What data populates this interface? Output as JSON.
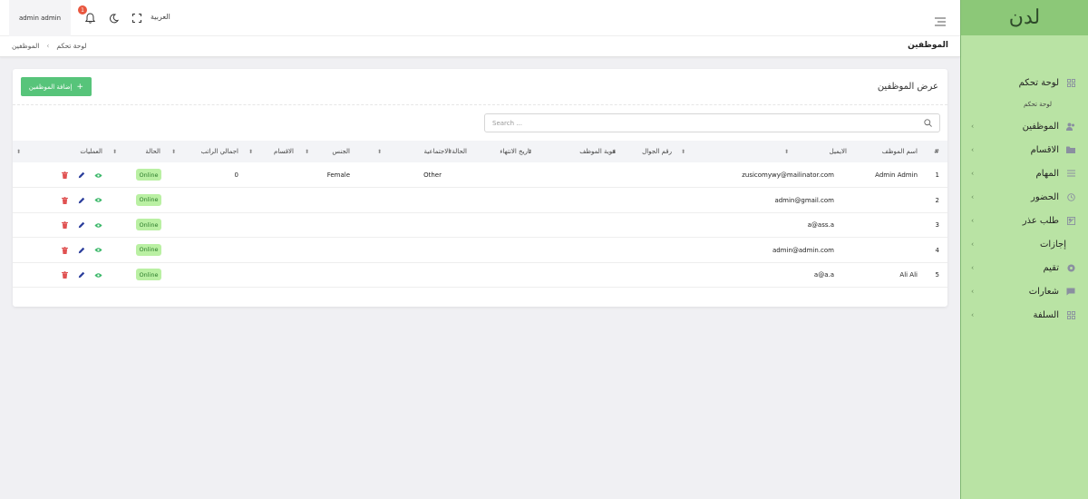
{
  "app": {
    "logo": "لدن"
  },
  "header": {
    "user": "admin admin",
    "notification_count": "1",
    "language": "العربية"
  },
  "breadcrumb": {
    "home": "لوحة تحكم",
    "current": "الموظفين"
  },
  "page": {
    "title": "الموظفين"
  },
  "card": {
    "title": "عرض الموظفين",
    "add_button": "إضافة الموظفين",
    "search_placeholder": "Search ..."
  },
  "sidebar": {
    "items": [
      {
        "label": "لوحة تحكم",
        "icon": "dashboard-icon"
      },
      {
        "label": "الموظفين",
        "icon": "users-icon"
      },
      {
        "label": "الاقسام",
        "icon": "folder-icon"
      },
      {
        "label": "المهام",
        "icon": "list-icon"
      },
      {
        "label": "الحضور",
        "icon": "clock-icon"
      },
      {
        "label": "طلب عذر",
        "icon": "excuse-icon"
      },
      {
        "label": "إجازات",
        "icon": ""
      },
      {
        "label": "تقيم",
        "icon": "rating-icon"
      },
      {
        "label": "شعارات",
        "icon": "chat-icon"
      },
      {
        "label": "السلفة",
        "icon": "grid-icon"
      }
    ],
    "sub_label": "لوحة تحكم"
  },
  "table": {
    "columns": [
      "#",
      "اسم الموظف",
      "الايميل",
      "رقم الجوال",
      "هوية الموظف",
      "تاريخ الانتهاء",
      "الحالة الاجتماعية",
      "الجنس",
      "الاقسام",
      "اجمالي الراتب",
      "الحالة",
      "العمليات"
    ],
    "rows": [
      {
        "num": "1",
        "name": "Admin Admin",
        "email": "zusicomywy@mailinator.com",
        "social": "Other",
        "gender": "Female",
        "salary": "0",
        "status": "Online"
      },
      {
        "num": "2",
        "name": "",
        "email": "admin@gmail.com",
        "social": "",
        "gender": "",
        "salary": "",
        "status": "Online"
      },
      {
        "num": "3",
        "name": "",
        "email": "a@ass.a",
        "social": "",
        "gender": "",
        "salary": "",
        "status": "Online"
      },
      {
        "num": "4",
        "name": "",
        "email": "admin@admin.com",
        "social": "",
        "gender": "",
        "salary": "",
        "status": "Online"
      },
      {
        "num": "5",
        "name": "Ali Ali",
        "email": "a@a.a",
        "social": "",
        "gender": "",
        "salary": "",
        "status": "Online"
      }
    ]
  },
  "colors": {
    "accent": "#57c47a",
    "sidebar_bg": "#b9e3a4",
    "logo_bar": "#8cc878",
    "badge_bg": "#baf0a3",
    "delete": "#e05252",
    "edit": "#2c3e9c",
    "view": "#3cb86a"
  }
}
